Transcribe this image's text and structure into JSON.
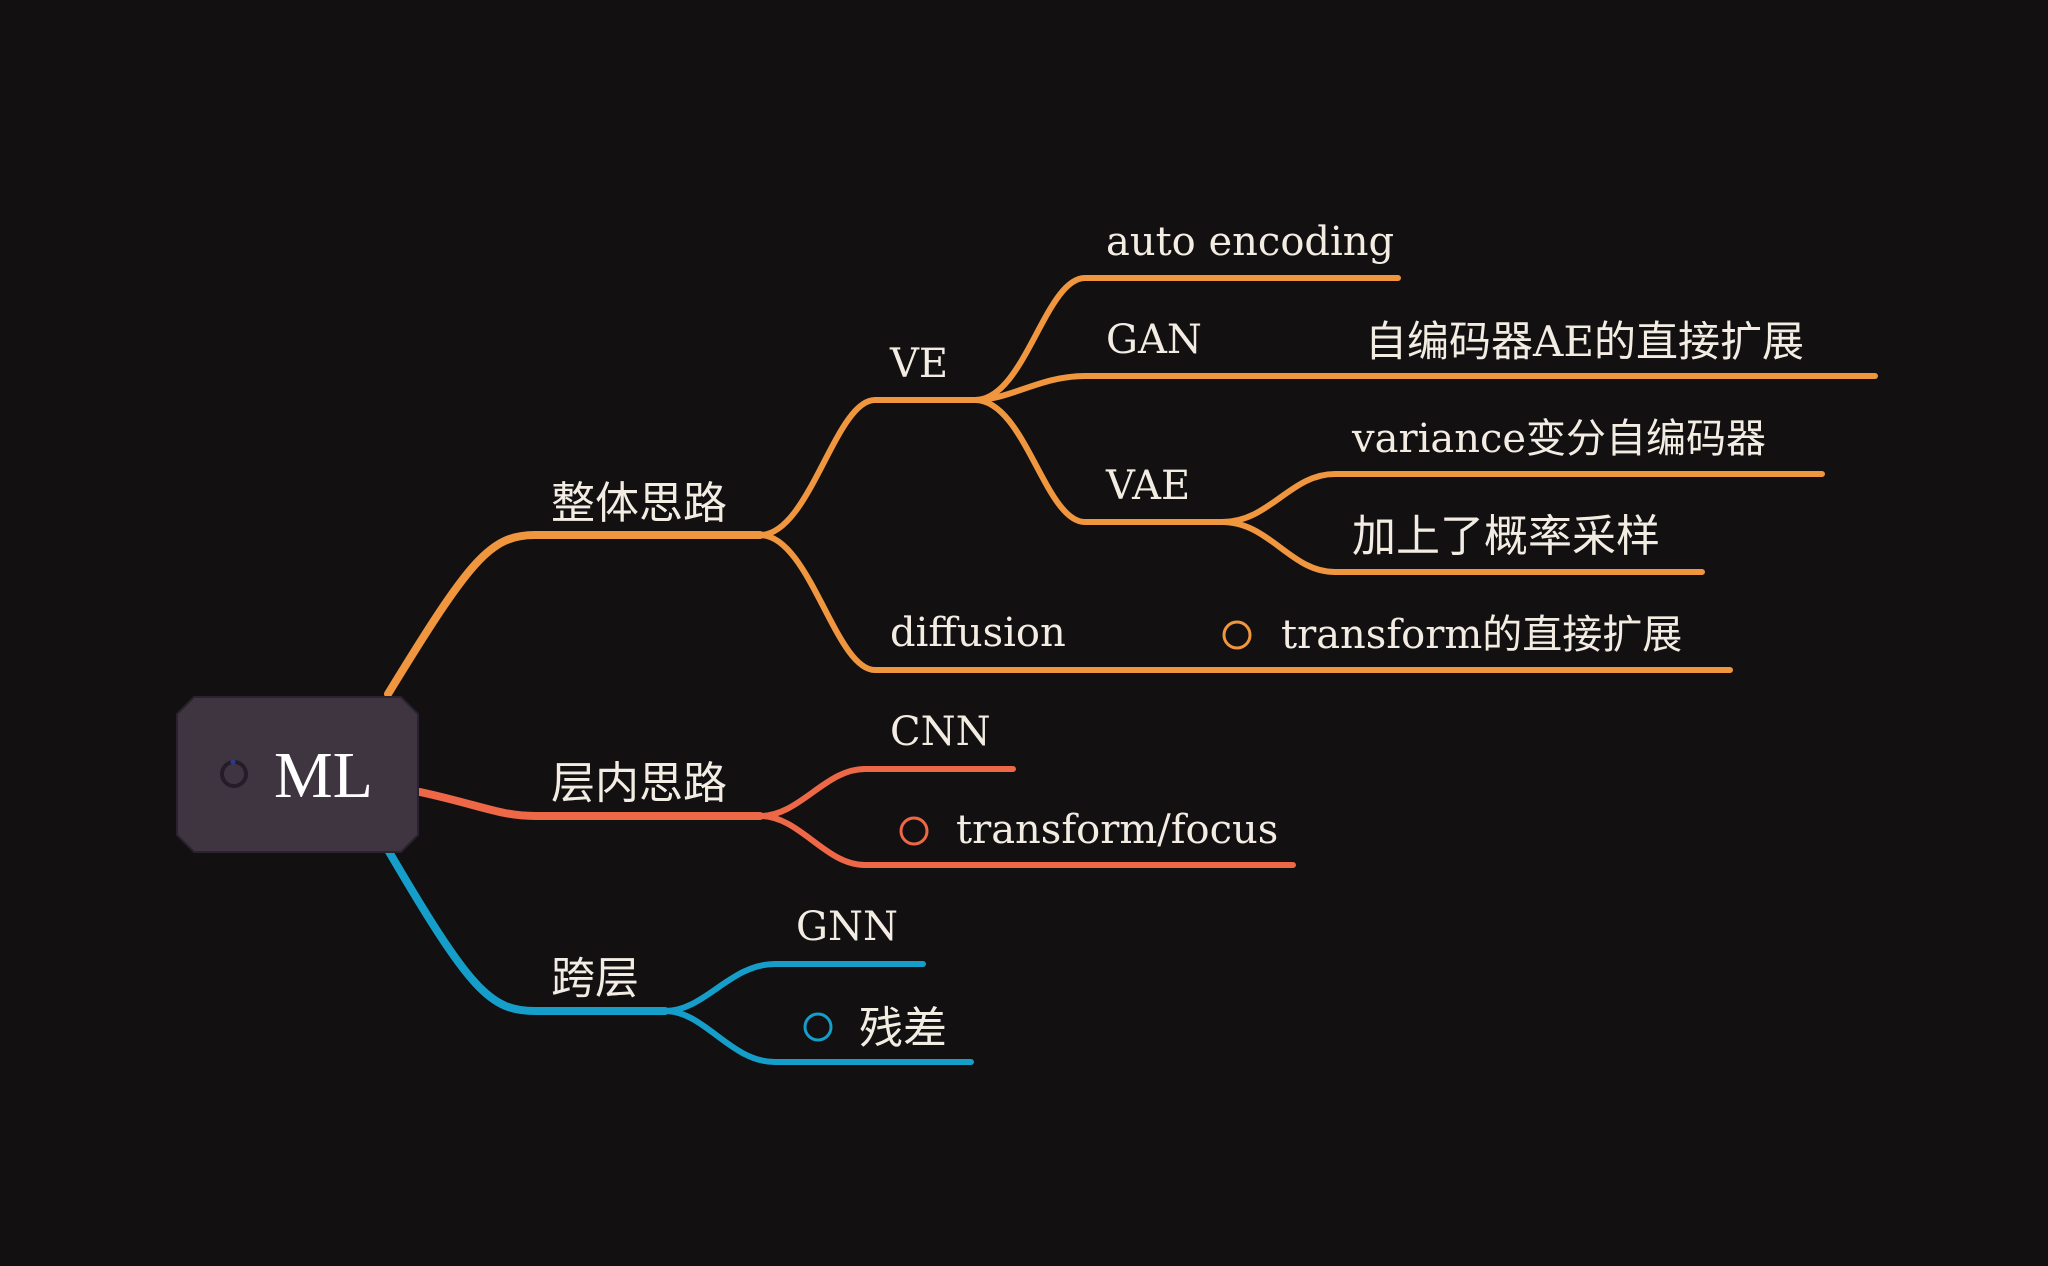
{
  "colors": {
    "background": "#121011",
    "branch_1": "#f0963e",
    "branch_2": "#ee6847",
    "branch_3": "#149ec9",
    "text": "#f3ece3",
    "root_fill": "#3f3541"
  },
  "mindmap": {
    "root": {
      "label": "ML"
    },
    "branches": [
      {
        "label": "整体思路",
        "children": [
          {
            "label": "VE",
            "children": [
              {
                "label": "auto encoding"
              },
              {
                "label": "GAN",
                "note": "自编码器AE的直接扩展"
              },
              {
                "label": "VAE",
                "children": [
                  {
                    "label": "variance变分自编码器"
                  },
                  {
                    "label": "加上了概率采样"
                  }
                ]
              }
            ]
          },
          {
            "label": "diffusion",
            "note": "transform的直接扩展",
            "note_icon": "circle-icon"
          }
        ]
      },
      {
        "label": "层内思路",
        "children": [
          {
            "label": "CNN"
          },
          {
            "label": "transform/focus",
            "icon": "circle-icon"
          }
        ]
      },
      {
        "label": "跨层",
        "children": [
          {
            "label": "GNN"
          },
          {
            "label": "残差",
            "icon": "circle-icon"
          }
        ]
      }
    ]
  }
}
